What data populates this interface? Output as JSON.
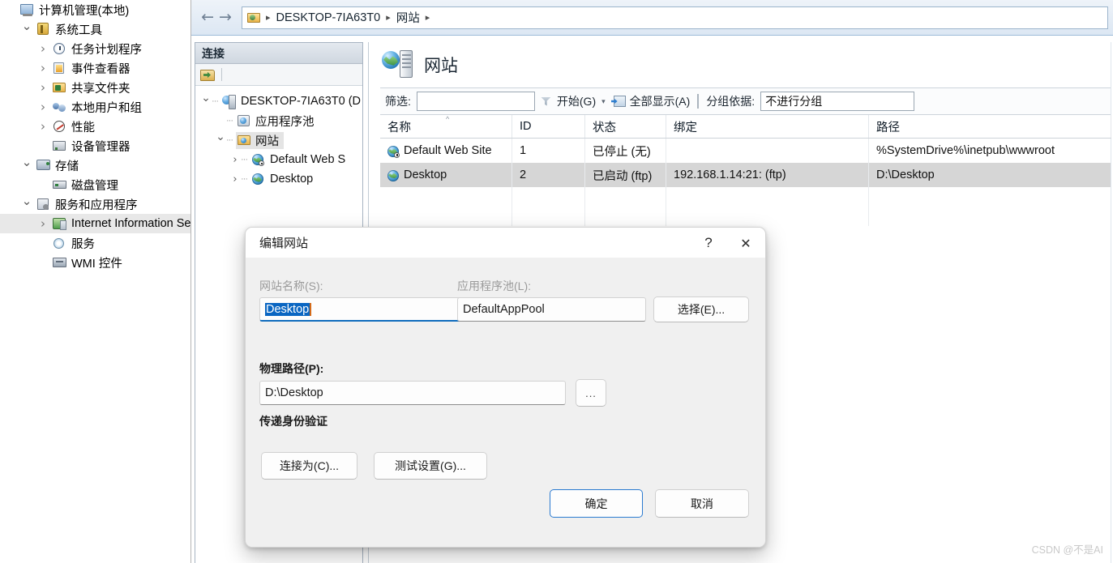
{
  "mmc": {
    "tree": [
      {
        "label": "计算机管理(本地)",
        "indent": 0,
        "twisty": "none",
        "icon": "computer-icon",
        "selected": false
      },
      {
        "label": "系统工具",
        "indent": 1,
        "twisty": "down",
        "icon": "tools-icon",
        "selected": false
      },
      {
        "label": "任务计划程序",
        "indent": 2,
        "twisty": "right",
        "icon": "clock-icon",
        "selected": false
      },
      {
        "label": "事件查看器",
        "indent": 2,
        "twisty": "right",
        "icon": "event-viewer-icon",
        "selected": false
      },
      {
        "label": "共享文件夹",
        "indent": 2,
        "twisty": "right",
        "icon": "shared-folder-icon",
        "selected": false
      },
      {
        "label": "本地用户和组",
        "indent": 2,
        "twisty": "right",
        "icon": "users-icon",
        "selected": false
      },
      {
        "label": "性能",
        "indent": 2,
        "twisty": "right",
        "icon": "performance-icon",
        "selected": false
      },
      {
        "label": "设备管理器",
        "indent": 2,
        "twisty": "none",
        "icon": "device-manager-icon",
        "selected": false
      },
      {
        "label": "存储",
        "indent": 1,
        "twisty": "down",
        "icon": "storage-icon",
        "selected": false
      },
      {
        "label": "磁盘管理",
        "indent": 2,
        "twisty": "none",
        "icon": "disk-management-icon",
        "selected": false
      },
      {
        "label": "服务和应用程序",
        "indent": 1,
        "twisty": "down",
        "icon": "services-apps-icon",
        "selected": false
      },
      {
        "label": "Internet Information Se",
        "indent": 2,
        "twisty": "right",
        "icon": "iis-icon",
        "selected": true
      },
      {
        "label": "服务",
        "indent": 2,
        "twisty": "none",
        "icon": "gear-icon",
        "selected": false
      },
      {
        "label": "WMI 控件",
        "indent": 2,
        "twisty": "none",
        "icon": "wmi-icon",
        "selected": false
      }
    ]
  },
  "addressbar": {
    "back_glyph": "←",
    "forward_glyph": "→",
    "crumbs": [
      "DESKTOP-7IA63T0",
      "网站"
    ],
    "separator": "▸"
  },
  "connections": {
    "title": "连接",
    "toolbar": {
      "connect_icon": "connect-to-server-icon"
    },
    "tree": [
      {
        "label": "DESKTOP-7IA63T0 (D",
        "indent": 0,
        "twisty": "down",
        "icon": "server-icon",
        "selected": false
      },
      {
        "label": "应用程序池",
        "indent": 1,
        "twisty": "none",
        "icon": "app-pools-icon",
        "selected": false
      },
      {
        "label": "网站",
        "indent": 1,
        "twisty": "down",
        "icon": "sites-folder-icon",
        "selected": true
      },
      {
        "label": "Default Web S",
        "indent": 2,
        "twisty": "right",
        "icon": "site-stopped-icon",
        "selected": false
      },
      {
        "label": "Desktop",
        "indent": 2,
        "twisty": "right",
        "icon": "site-icon",
        "selected": false
      }
    ]
  },
  "content": {
    "title": "网站",
    "title_icon": "websites-icon",
    "filter": {
      "label": "筛选:",
      "value": "",
      "placeholder": "",
      "go_label": "开始(G)",
      "go_icon": "funnel-icon",
      "caret_glyph": "▾",
      "showall_label": "全部显示(A)",
      "showall_icon": "show-all-icon",
      "groupby_label": "分组依据:",
      "groupby_value": "不进行分组"
    },
    "table": {
      "columns": [
        "名称",
        "ID",
        "状态",
        "绑定",
        "路径"
      ],
      "sorted_column_index": 0,
      "sort_glyph": "^",
      "rows": [
        {
          "icon": "site-stopped-icon",
          "name": "Default Web Site",
          "id": "1",
          "state": "已停止 (无)",
          "binding": "",
          "path": "%SystemDrive%\\inetpub\\wwwroot",
          "selected": false
        },
        {
          "icon": "site-icon",
          "name": "Desktop",
          "id": "2",
          "state": "已启动 (ftp)",
          "binding": "192.168.1.14:21: (ftp)",
          "path": "D:\\Desktop",
          "selected": true
        }
      ]
    }
  },
  "dialog": {
    "title": "编辑网站",
    "help_glyph": "?",
    "close_glyph": "✕",
    "site_name_label": "网站名称(S):",
    "site_name_value": "Desktop",
    "site_name_selected": true,
    "app_pool_label": "应用程序池(L):",
    "app_pool_value": "DefaultAppPool",
    "select_button": "选择(E)...",
    "physical_path_label": "物理路径(P):",
    "physical_path_value": "D:\\Desktop",
    "browse_button": "...",
    "passthrough_label": "传递身份验证",
    "connect_as_button": "连接为(C)...",
    "test_settings_button": "测试设置(G)...",
    "ok_button": "确定",
    "cancel_button": "取消"
  },
  "watermark": {
    "text": "CSDN @不是AI"
  },
  "colors": {
    "accent": "#0f6cbd",
    "selection": "#0a66c2",
    "row_selected": "#d6d6d6",
    "dialog_bg": "#f0f0f0",
    "caret": "#d46b1a"
  }
}
